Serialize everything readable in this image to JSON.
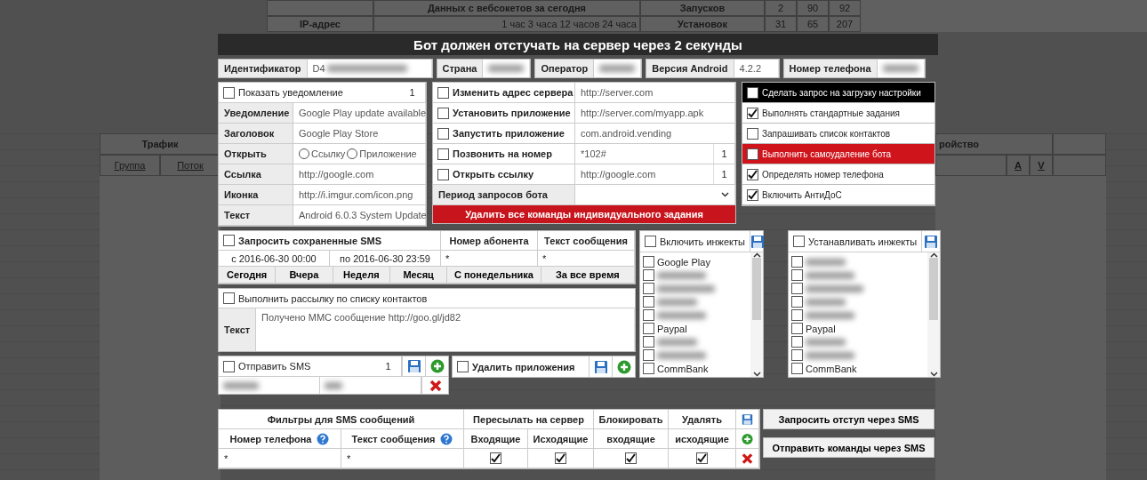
{
  "background": {
    "stats": {
      "ip_label": "IP-адрес",
      "websocket_label": "Данных с вебсокетов за сегодня",
      "periods": [
        "1 час",
        "3 часа",
        "12 часов",
        "24 часа"
      ],
      "metrics": [
        {
          "label": "Запусков",
          "values": [
            "2",
            "90",
            "92"
          ]
        },
        {
          "label": "Установок",
          "values": [
            "31",
            "65",
            "207"
          ]
        }
      ]
    },
    "table": {
      "group_left": "Трафик",
      "columns_left": [
        "Группа",
        "Поток"
      ],
      "group_right": "ройство",
      "columns_right": [
        "А",
        "V"
      ]
    }
  },
  "dialog": {
    "title": "Бот должен отстучать на сервер через 2 секунды",
    "info": [
      {
        "label": "Идентификатор",
        "value": "D4",
        "redacted": true
      },
      {
        "label": "Страна",
        "redacted": true
      },
      {
        "label": "Оператор",
        "redacted": true
      },
      {
        "label": "Версия Android",
        "value": "4.2.2",
        "redacted": false
      },
      {
        "label": "Номер телефона",
        "redacted": true
      }
    ],
    "notification": {
      "checkbox": {
        "label": "Показать уведомление",
        "checked": false
      },
      "count": "1",
      "fields": [
        {
          "kind": "text",
          "label": "Уведомление",
          "value": "Google Play update available"
        },
        {
          "kind": "text",
          "label": "Заголовок",
          "value": "Google Play Store"
        },
        {
          "kind": "radio",
          "label": "Открыть",
          "options": [
            {
              "label": "Ссылку",
              "selected": false
            },
            {
              "label": "Приложение",
              "selected": false
            }
          ]
        },
        {
          "kind": "text",
          "label": "Ссылка",
          "value": "http://google.com"
        },
        {
          "kind": "text",
          "label": "Иконка",
          "value": "http://i.imgur.com/icon.png"
        },
        {
          "kind": "text",
          "label": "Текст",
          "value": "Android 6.0.3 System Update"
        }
      ]
    },
    "commands": {
      "items": [
        {
          "label": "Изменить адрес сервера",
          "checked": false,
          "value": "http://server.com"
        },
        {
          "label": "Установить приложение",
          "checked": false,
          "value": "http://server.com/myapp.apk"
        },
        {
          "label": "Запустить приложение",
          "checked": false,
          "value": "com.android.vending"
        },
        {
          "label": "Позвонить на номер",
          "checked": false,
          "value": "*102#",
          "count": "1"
        },
        {
          "label": "Открыть ссылку",
          "checked": false,
          "value": "http://google.com",
          "count": "1"
        }
      ],
      "period_label": "Период запросов бота",
      "delete_button": "Удалить все команды индивидуального задания"
    },
    "options": [
      {
        "label": "Сделать запрос на загрузку настройки",
        "checked": false,
        "kind": "dark"
      },
      {
        "label": "Выполнять стандартные задания",
        "checked": true,
        "kind": "plain"
      },
      {
        "label": "Запрашивать список контактов",
        "checked": false,
        "kind": "plain"
      },
      {
        "label": "Выполнить самоудаление бота",
        "checked": false,
        "kind": "danger"
      },
      {
        "label": "Определять номер телефона",
        "checked": true,
        "kind": "plain"
      },
      {
        "label": "Включить АнтиДоС",
        "checked": true,
        "kind": "plain"
      }
    ],
    "sms_request": {
      "checkbox": {
        "label": "Запросить сохраненные SMS",
        "checked": false
      },
      "columns": [
        "Номер абонента",
        "Текст сообщения"
      ],
      "from": "с 2016-06-30 00:00",
      "to": "по 2016-06-30 23:59",
      "filters": [
        "*",
        "*"
      ],
      "ranges": [
        "Сегодня",
        "Вчера",
        "Неделя",
        "Месяц",
        "С понедельника",
        "За все время"
      ]
    },
    "mailing": {
      "checkbox": {
        "label": "Выполнить рассылку по списку контактов",
        "checked": false
      },
      "text_label": "Текст",
      "text": "Получено ММС сообщение http://goo.gl/jd82"
    },
    "send_sms": {
      "checkbox": {
        "label": "Отправить SMS",
        "checked": false
      },
      "count": "1"
    },
    "delete_apps": {
      "checkbox": {
        "label": "Удалить приложения",
        "checked": false
      }
    },
    "injects": [
      {
        "checkbox": {
          "label": "Включить инжекты",
          "checked": false
        },
        "items": [
          {
            "label": "Google Play",
            "checked": false
          },
          {
            "redacted": true,
            "checked": false
          },
          {
            "redacted": true,
            "checked": false
          },
          {
            "redacted": true,
            "checked": false
          },
          {
            "redacted": true,
            "checked": false
          },
          {
            "label": "Paypal",
            "checked": false
          },
          {
            "redacted": true,
            "checked": false
          },
          {
            "redacted": true,
            "checked": false
          },
          {
            "label": "CommBank",
            "checked": false
          }
        ]
      },
      {
        "checkbox": {
          "label": "Устанавливать инжекты",
          "checked": false
        },
        "items": [
          {
            "redacted": true,
            "checked": false
          },
          {
            "redacted": true,
            "checked": false
          },
          {
            "redacted": true,
            "checked": false
          },
          {
            "redacted": true,
            "checked": false
          },
          {
            "redacted": true,
            "checked": false
          },
          {
            "label": "Paypal",
            "checked": false
          },
          {
            "redacted": true,
            "checked": false
          },
          {
            "redacted": true,
            "checked": false
          },
          {
            "label": "CommBank",
            "checked": false
          }
        ]
      }
    ],
    "sms_filters": {
      "title": "Фильтры для SMS сообщений",
      "groups": [
        "Пересылать на сервер",
        "Блокировать",
        "Удалять"
      ],
      "columns": [
        "Номер телефона",
        "Текст сообщения",
        "Входящие",
        "Исходящие",
        "входящие",
        "исходящие"
      ],
      "rows": [
        {
          "phone": "*",
          "text": "*",
          "flags": [
            {
              "checked": true
            },
            {
              "checked": true
            },
            {
              "checked": true
            },
            {
              "checked": true
            }
          ]
        }
      ]
    },
    "actions": [
      "Запросить отступ через SMS",
      "Отправить команды через SMS"
    ]
  }
}
